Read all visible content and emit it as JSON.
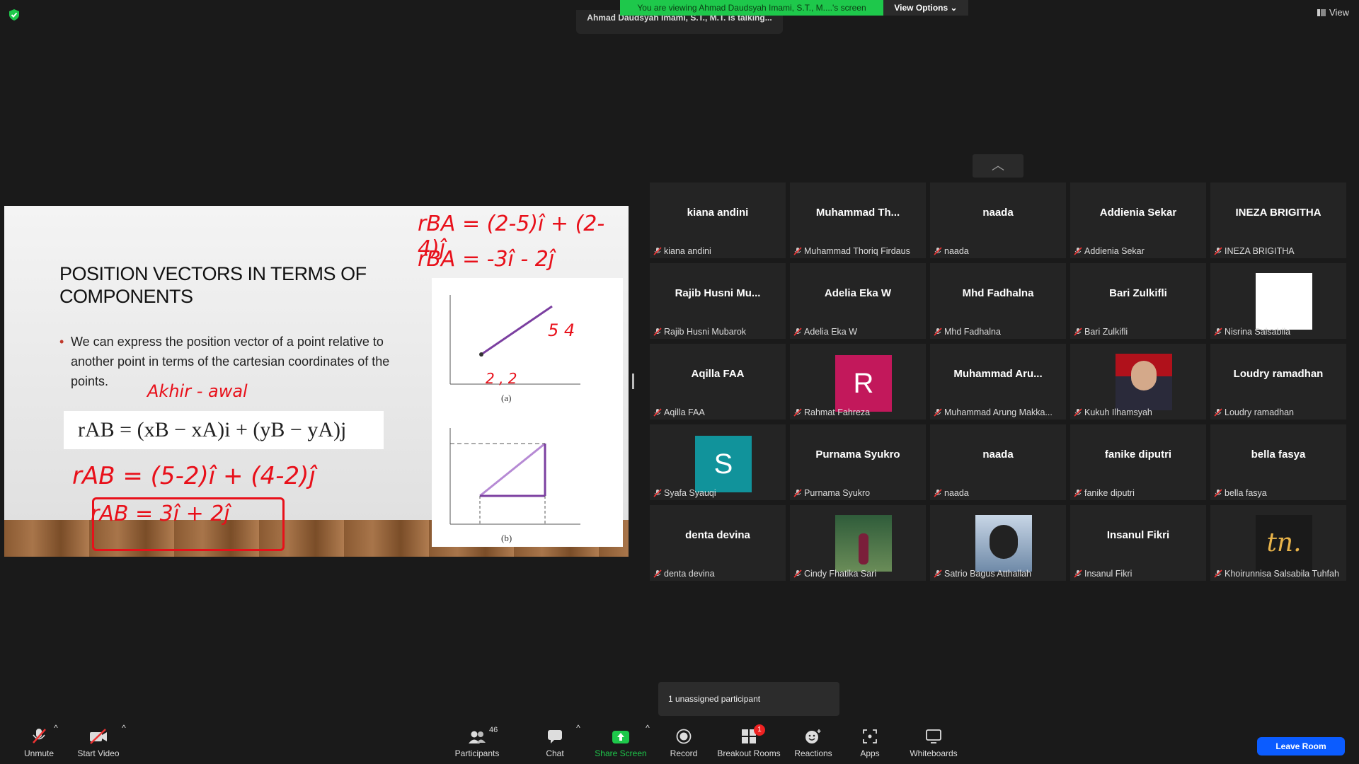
{
  "banner": "You are viewing Ahmad Daudsyah Imami, S.T., M....'s screen",
  "view_options": "View Options",
  "talking": "Ahmad Daudsyah Imami, S.T., M.T. is talking...",
  "view_button": "View",
  "slide": {
    "title": "POSITION VECTORS IN TERMS OF COMPONENTS",
    "bullet": "We can express the position vector of a point relative to another point in terms of the cartesian coordinates of the points.",
    "formula": "rAB = (xB − xA)i + (yB − yA)j",
    "figure_a_label": "(a)",
    "figure_b_label": "(b)",
    "annotations": [
      "rBA = (2-5)î + (2-4)ĵ",
      "rBA = -3î - 2ĵ",
      "Akhir - awal",
      "rAB = (5-2)î + (4-2)ĵ",
      "rAB = 3î + 2ĵ",
      "5 4",
      "2 , 2"
    ]
  },
  "participants": [
    {
      "big": "kiana andini",
      "name": "kiana andini"
    },
    {
      "big": "Muhammad  Th...",
      "name": "Muhammad Thoriq Firdaus"
    },
    {
      "big": "naada",
      "name": "naada"
    },
    {
      "big": "Addienia Sekar",
      "name": "Addienia Sekar"
    },
    {
      "big": "INEZA BRIGITHA",
      "name": "INEZA BRIGITHA"
    },
    {
      "big": "Rajib  Husni  Mu...",
      "name": "Rajib Husni Mubarok"
    },
    {
      "big": "Adelia Eka W",
      "name": "Adelia Eka W"
    },
    {
      "big": "Mhd Fadhalna",
      "name": "Mhd Fadhalna"
    },
    {
      "big": "Bari Zulkifli",
      "name": "Bari Zulkifli"
    },
    {
      "big": "",
      "name": "Nisrina Salsabila"
    },
    {
      "big": "Aqilla FAA",
      "name": "Aqilla FAA"
    },
    {
      "big": "",
      "name": "Rahmat Fahreza",
      "avatar": "R",
      "color": "#c2185b"
    },
    {
      "big": "Muhammad  Aru...",
      "name": "Muhammad Arung Makka..."
    },
    {
      "big": "",
      "name": "Kukuh Ilhamsyah"
    },
    {
      "big": "Loudry ramadhan",
      "name": "Loudry ramadhan"
    },
    {
      "big": "",
      "name": "Syafa Syauqi",
      "avatar": "S",
      "color": "#11939b"
    },
    {
      "big": "Purnama Syukro",
      "name": "Purnama Syukro"
    },
    {
      "big": "naada",
      "name": "naada"
    },
    {
      "big": "fanike diputri",
      "name": "fanike diputri"
    },
    {
      "big": "bella fasya",
      "name": "bella fasya"
    },
    {
      "big": "denta devina",
      "name": "denta devina"
    },
    {
      "big": "",
      "name": "Cindy Fhatika Sari"
    },
    {
      "big": "",
      "name": "Satrio Bagus Atthallah"
    },
    {
      "big": "Insanul Fikri",
      "name": "Insanul Fikri"
    },
    {
      "big": "",
      "name": "Khoirunnisa Salsabila Tuhfah",
      "logo": "tn."
    }
  ],
  "unassigned": "1 unassigned participant",
  "toolbar": {
    "unmute": "Unmute",
    "start_video": "Start Video",
    "participants": "Participants",
    "participants_count": "46",
    "chat": "Chat",
    "share_screen": "Share Screen",
    "record": "Record",
    "breakout": "Breakout Rooms",
    "breakout_badge": "1",
    "reactions": "Reactions",
    "apps": "Apps",
    "whiteboards": "Whiteboards",
    "leave": "Leave Room"
  }
}
